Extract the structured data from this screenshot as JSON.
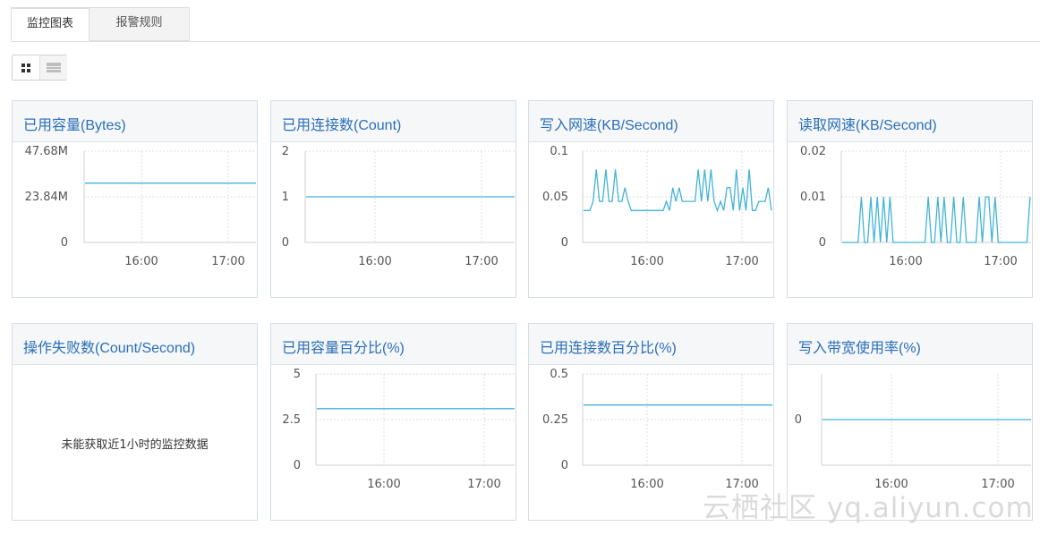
{
  "tabs": [
    {
      "label": "监控图表"
    },
    {
      "label": "报警规则"
    }
  ],
  "view_toggle": {
    "grid_icon": "grid-icon",
    "list_icon": "list-icon"
  },
  "colors": {
    "line": "#42b3d9",
    "title": "#2b6fb8",
    "grid": "#dcdcdc"
  },
  "panels": [
    {
      "title": "已用容量(Bytes)"
    },
    {
      "title": "已用连接数(Count)"
    },
    {
      "title": "写入网速(KB/Second)"
    },
    {
      "title": "读取网速(KB/Second)"
    },
    {
      "title": "操作失败数(Count/Second)",
      "no_data": "未能获取近1小时的监控数据"
    },
    {
      "title": "已用容量百分比(%)"
    },
    {
      "title": "已用连接数百分比(%)"
    },
    {
      "title": "写入带宽使用率(%)"
    }
  ],
  "chart_data": [
    {
      "type": "line",
      "title": "已用容量(Bytes)",
      "y_ticks": [
        "47.68M",
        "23.84M",
        "0"
      ],
      "ylim": [
        0,
        47.68
      ],
      "x_ticks": [
        "16:00",
        "17:00"
      ],
      "x": [
        "15:20",
        "17:15"
      ],
      "y": [
        31.0,
        31.0
      ]
    },
    {
      "type": "line",
      "title": "已用连接数(Count)",
      "y_ticks": [
        "2",
        "1",
        "0"
      ],
      "ylim": [
        0,
        2
      ],
      "x_ticks": [
        "16:00",
        "17:00"
      ],
      "x": [
        "15:20",
        "17:15"
      ],
      "y": [
        1,
        1
      ]
    },
    {
      "type": "line",
      "title": "写入网速(KB/Second)",
      "y_ticks": [
        "0.1",
        "0.05",
        "0"
      ],
      "ylim": [
        0,
        0.1
      ],
      "x_ticks": [
        "16:00",
        "17:00"
      ],
      "y": [
        0.035,
        0.035,
        0.035,
        0.045,
        0.08,
        0.045,
        0.045,
        0.08,
        0.045,
        0.045,
        0.08,
        0.045,
        0.045,
        0.06,
        0.045,
        0.035,
        0.035,
        0.035,
        0.035,
        0.035,
        0.035,
        0.035,
        0.035,
        0.035,
        0.035,
        0.035,
        0.045,
        0.035,
        0.06,
        0.045,
        0.06,
        0.045,
        0.045,
        0.045,
        0.045,
        0.045,
        0.08,
        0.045,
        0.08,
        0.045,
        0.08,
        0.045,
        0.035,
        0.045,
        0.035,
        0.06,
        0.06,
        0.035,
        0.08,
        0.035,
        0.06,
        0.035,
        0.08,
        0.035,
        0.035,
        0.045,
        0.045,
        0.045,
        0.06,
        0.035
      ]
    },
    {
      "type": "line",
      "title": "读取网速(KB/Second)",
      "y_ticks": [
        "0.02",
        "0.01",
        "0"
      ],
      "ylim": [
        0,
        0.02
      ],
      "x_ticks": [
        "16:00",
        "17:00"
      ],
      "y": [
        0,
        0,
        0,
        0,
        0,
        0,
        0.01,
        0,
        0,
        0.01,
        0,
        0.01,
        0,
        0.01,
        0,
        0.01,
        0,
        0,
        0,
        0,
        0,
        0,
        0,
        0,
        0,
        0,
        0,
        0.01,
        0,
        0,
        0.01,
        0,
        0.01,
        0,
        0,
        0.01,
        0,
        0,
        0.01,
        0,
        0,
        0,
        0,
        0.01,
        0,
        0.01,
        0.01,
        0,
        0.01,
        0,
        0,
        0,
        0,
        0,
        0,
        0,
        0,
        0,
        0,
        0.01
      ]
    },
    {
      "type": "line",
      "title": "操作失败数(Count/Second)",
      "empty": true
    },
    {
      "type": "line",
      "title": "已用容量百分比(%)",
      "y_ticks": [
        "5",
        "2.5",
        "0"
      ],
      "ylim": [
        0,
        5
      ],
      "x_ticks": [
        "16:00",
        "17:00"
      ],
      "x": [
        "15:20",
        "17:15"
      ],
      "y": [
        3.1,
        3.1
      ]
    },
    {
      "type": "line",
      "title": "已用连接数百分比(%)",
      "y_ticks": [
        "0.5",
        "0.25",
        "0"
      ],
      "ylim": [
        0,
        0.5
      ],
      "x_ticks": [
        "16:00",
        "17:00"
      ],
      "x": [
        "15:20",
        "17:15"
      ],
      "y": [
        0.33,
        0.33
      ]
    },
    {
      "type": "line",
      "title": "写入带宽使用率(%)",
      "y_ticks": [
        "0"
      ],
      "ylim": [
        -1,
        1
      ],
      "x_ticks": [
        "16:00",
        "17:00"
      ],
      "x": [
        "15:20",
        "17:15"
      ],
      "y": [
        0,
        0
      ]
    }
  ],
  "watermark": "云栖社区 yq.aliyun.com"
}
